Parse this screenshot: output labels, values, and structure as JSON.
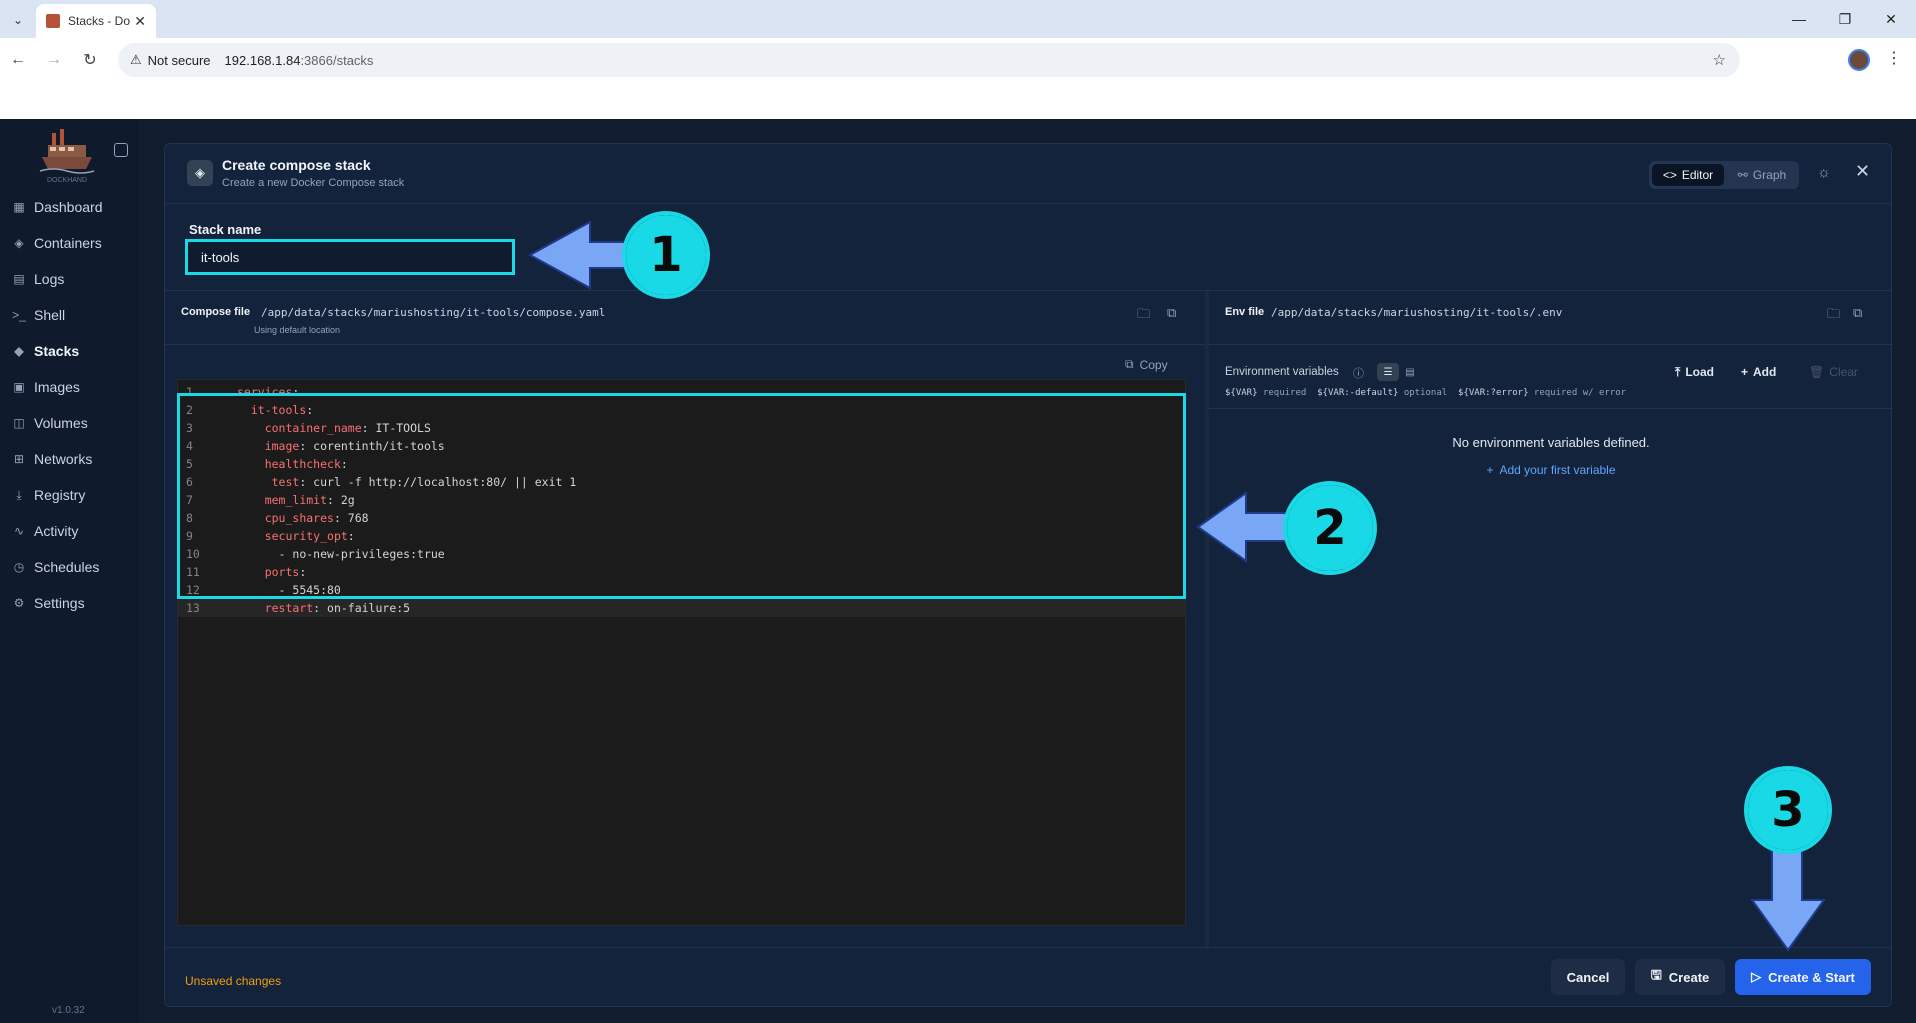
{
  "browser": {
    "tab_title": "Stacks - Do",
    "security_label": "Not secure",
    "url_host": "192.168.1.84",
    "url_path": ":3866/stacks"
  },
  "sidebar": {
    "logo_text": "DOCKHAND",
    "items": [
      {
        "label": "Dashboard",
        "icon": "grid-icon"
      },
      {
        "label": "Containers",
        "icon": "box-icon"
      },
      {
        "label": "Logs",
        "icon": "file-icon"
      },
      {
        "label": "Shell",
        "icon": "terminal-icon"
      },
      {
        "label": "Stacks",
        "icon": "layers-icon"
      },
      {
        "label": "Images",
        "icon": "image-icon"
      },
      {
        "label": "Volumes",
        "icon": "database-icon"
      },
      {
        "label": "Networks",
        "icon": "network-icon"
      },
      {
        "label": "Registry",
        "icon": "download-icon"
      },
      {
        "label": "Activity",
        "icon": "activity-icon"
      },
      {
        "label": "Schedules",
        "icon": "clock-icon"
      },
      {
        "label": "Settings",
        "icon": "gear-icon"
      }
    ],
    "version": "v1.0.32"
  },
  "modal": {
    "title": "Create compose stack",
    "subtitle": "Create a new Docker Compose stack",
    "editor_label": "Editor",
    "graph_label": "Graph",
    "stack_name_label": "Stack name",
    "stack_name_value": "it-tools",
    "compose": {
      "label": "Compose file",
      "path": "/app/data/stacks/mariushosting/it-tools/compose.yaml",
      "hint": "Using default location",
      "copy_label": "Copy",
      "lines": [
        {
          "n": "1",
          "indent": "",
          "key": "services",
          "rest": ":"
        },
        {
          "n": "2",
          "indent": "  ",
          "key": "it-tools",
          "rest": ":"
        },
        {
          "n": "3",
          "indent": "    ",
          "key": "container_name",
          "rest": ": IT-TOOLS"
        },
        {
          "n": "4",
          "indent": "    ",
          "key": "image",
          "rest": ": corentinth/it-tools"
        },
        {
          "n": "5",
          "indent": "    ",
          "key": "healthcheck",
          "rest": ":"
        },
        {
          "n": "6",
          "indent": "     ",
          "key": "test",
          "rest": ": curl -f http://localhost:80/ || exit 1"
        },
        {
          "n": "7",
          "indent": "    ",
          "key": "mem_limit",
          "rest": ": 2g"
        },
        {
          "n": "8",
          "indent": "    ",
          "key": "cpu_shares",
          "rest": ": 768"
        },
        {
          "n": "9",
          "indent": "    ",
          "key": "security_opt",
          "rest": ":"
        },
        {
          "n": "10",
          "indent": "      ",
          "key": "",
          "rest": "- no-new-privileges:true"
        },
        {
          "n": "11",
          "indent": "    ",
          "key": "ports",
          "rest": ":"
        },
        {
          "n": "12",
          "indent": "      ",
          "key": "",
          "rest": "- 5545:80"
        },
        {
          "n": "13",
          "indent": "    ",
          "key": "restart",
          "rest": ": on-failure:5"
        }
      ]
    },
    "env": {
      "label": "Env file",
      "path": "/app/data/stacks/mariushosting/it-tools/.env",
      "vars_label": "Environment variables",
      "load_label": "Load",
      "add_label": "Add",
      "clear_label": "Clear",
      "legend_1_code": "${VAR}",
      "legend_1_text": "required",
      "legend_2_code": "${VAR:-default}",
      "legend_2_text": "optional",
      "legend_3_code": "${VAR:?error}",
      "legend_3_text": "required w/ error",
      "empty_text": "No environment variables defined.",
      "add_first_label": "Add your first variable"
    },
    "footer": {
      "unsaved": "Unsaved changes",
      "cancel": "Cancel",
      "create": "Create",
      "create_start": "Create & Start"
    }
  },
  "annotations": {
    "badge_1": "1",
    "badge_2": "2",
    "badge_3": "3",
    "accent_color": "#19d9e6",
    "arrow_color": "#7aa7f5"
  }
}
